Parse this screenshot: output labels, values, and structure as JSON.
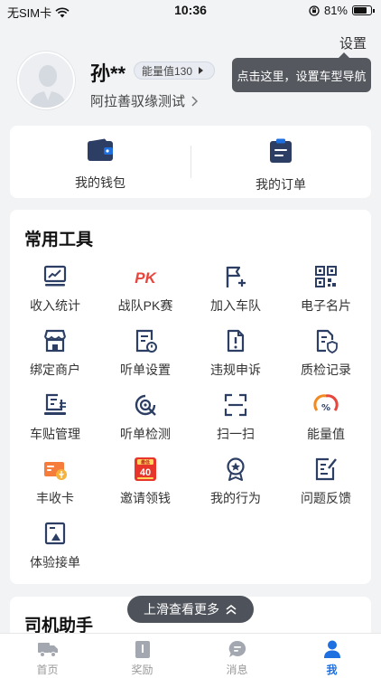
{
  "status": {
    "carrier": "无SIM卡",
    "time": "10:36",
    "battery": "81%",
    "battery_level": 0.81
  },
  "header": {
    "settings_label": "设置",
    "tooltip": "点击这里，设置车型导航",
    "username": "孙**",
    "energy_badge": "能量值130",
    "company": "阿拉善驭缘测试"
  },
  "shortcuts": [
    {
      "label": "我的钱包",
      "icon": "wallet-icon"
    },
    {
      "label": "我的订单",
      "icon": "order-icon"
    }
  ],
  "tools": {
    "title": "常用工具",
    "items": [
      {
        "label": "收入统计",
        "icon": "income-chart-icon"
      },
      {
        "label": "战队PK赛",
        "icon": "pk-icon",
        "glyph": "PK"
      },
      {
        "label": "加入车队",
        "icon": "flag-plus-icon"
      },
      {
        "label": "电子名片",
        "icon": "qr-code-icon"
      },
      {
        "label": "绑定商户",
        "icon": "store-icon"
      },
      {
        "label": "听单设置",
        "icon": "order-settings-icon"
      },
      {
        "label": "违规申诉",
        "icon": "appeal-icon"
      },
      {
        "label": "质检记录",
        "icon": "quality-check-icon"
      },
      {
        "label": "车贴管理",
        "icon": "car-sticker-icon"
      },
      {
        "label": "听单检测",
        "icon": "detect-icon"
      },
      {
        "label": "扫一扫",
        "icon": "scan-icon"
      },
      {
        "label": "能量值",
        "icon": "energy-gauge-icon"
      },
      {
        "label": "丰收卡",
        "icon": "harvest-card-icon"
      },
      {
        "label": "邀请领钱",
        "icon": "invite-red-packet-icon",
        "badge_top": "最低",
        "badge_num": "40"
      },
      {
        "label": "我的行为",
        "icon": "behavior-medal-icon"
      },
      {
        "label": "问题反馈",
        "icon": "feedback-icon"
      },
      {
        "label": "体验接单",
        "icon": "trial-order-icon"
      }
    ]
  },
  "assistant": {
    "title": "司机助手"
  },
  "scroll_hint": "上滑查看更多",
  "tabs": [
    {
      "label": "首页",
      "icon": "truck-icon",
      "active": false
    },
    {
      "label": "奖励",
      "icon": "reward-icon",
      "active": false
    },
    {
      "label": "消息",
      "icon": "message-icon",
      "active": false
    },
    {
      "label": "我",
      "icon": "person-icon",
      "active": true
    }
  ],
  "colors": {
    "accent": "#1e6fe0",
    "navy": "#2c3e63",
    "pk_red": "#e8463c",
    "energy_orange": "#f08a24"
  }
}
